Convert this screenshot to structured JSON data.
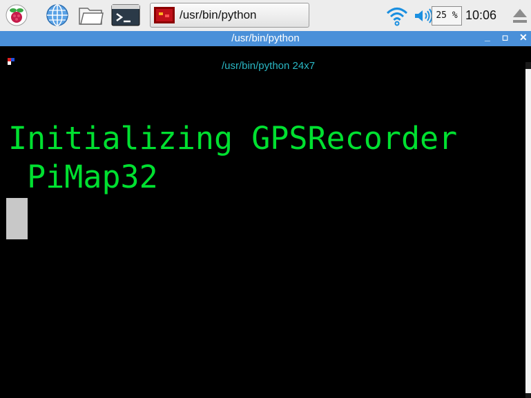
{
  "panel": {
    "task_button_label": "/usr/bin/python",
    "cpu_usage": "25 %",
    "clock": "10:06"
  },
  "window": {
    "title": "/usr/bin/python",
    "minimize_label": "_",
    "maximize_label": "◻",
    "close_label": "✕"
  },
  "terminal": {
    "header": "/usr/bin/python 24x7",
    "lines": [
      "Initializing GPSRecorder",
      " PiMap32"
    ]
  },
  "colors": {
    "terminal_text": "#00e030",
    "terminal_header": "#2ab7c4",
    "titlebar": "#4a90d9",
    "panel": "#ededed"
  },
  "icons": [
    "raspberry-icon",
    "globe-icon",
    "folder-icon",
    "terminal-icon",
    "wifi-icon",
    "volume-icon",
    "eject-icon"
  ]
}
